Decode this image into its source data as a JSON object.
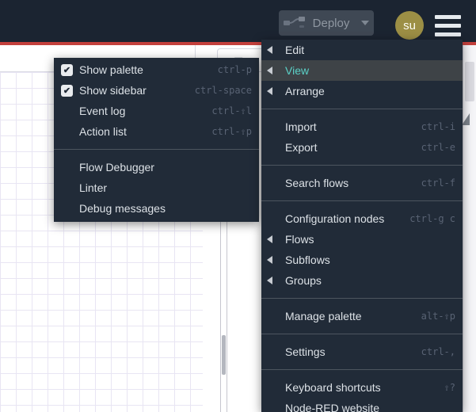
{
  "header": {
    "deploy_label": "Deploy",
    "avatar_initials": "su"
  },
  "tabbar": {
    "toolbox_icon": "list-icon"
  },
  "right_menu": {
    "highlight_color": "#5bd1c7",
    "items": [
      {
        "label": "Edit",
        "caret": true
      },
      {
        "label": "View",
        "caret": true,
        "highlighted": true
      },
      {
        "label": "Arrange",
        "caret": true
      },
      {
        "separator": true
      },
      {
        "label": "Import",
        "shortcut": "ctrl-i"
      },
      {
        "label": "Export",
        "shortcut": "ctrl-e"
      },
      {
        "separator": true
      },
      {
        "label": "Search flows",
        "shortcut": "ctrl-f"
      },
      {
        "separator": true
      },
      {
        "label": "Configuration nodes",
        "shortcut": "ctrl-g c"
      },
      {
        "label": "Flows",
        "caret": true
      },
      {
        "label": "Subflows",
        "caret": true
      },
      {
        "label": "Groups",
        "caret": true
      },
      {
        "separator": true
      },
      {
        "label": "Manage palette",
        "shortcut": "alt-⇧p"
      },
      {
        "separator": true
      },
      {
        "label": "Settings",
        "shortcut": "ctrl-,"
      },
      {
        "separator": true
      },
      {
        "label": "Keyboard shortcuts",
        "shortcut": "⇧?"
      },
      {
        "label": "Node-RED website"
      }
    ]
  },
  "view_submenu": {
    "items": [
      {
        "label": "Show palette",
        "checked": true,
        "shortcut": "ctrl-p"
      },
      {
        "label": "Show sidebar",
        "checked": true,
        "shortcut": "ctrl-space"
      },
      {
        "label": "Event log",
        "shortcut": "ctrl-⇧l"
      },
      {
        "label": "Action list",
        "shortcut": "ctrl-⇧p"
      },
      {
        "separator": true
      },
      {
        "label": "Flow Debugger"
      },
      {
        "label": "Linter"
      },
      {
        "label": "Debug messages"
      }
    ]
  },
  "colors": {
    "header_bg": "#1b2431",
    "accent_red": "#c3403c",
    "menu_bg": "#212b38",
    "menu_highlight_bg": "#3e4347",
    "menu_text": "#dce1e6",
    "shortcut_text": "#596374",
    "avatar_bg": "#9c8f45",
    "grid_line": "#e8e5f3"
  }
}
